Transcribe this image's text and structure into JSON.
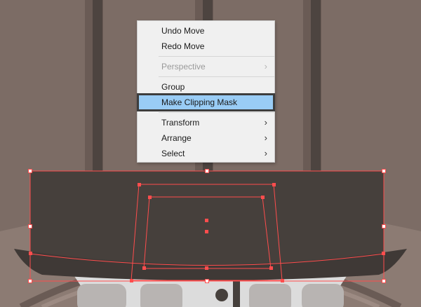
{
  "colors": {
    "background": "#7c6c65",
    "dark_shape": "#46403c",
    "selection": "#ff4d4d",
    "highlight": "#99ccf5"
  },
  "context_menu": {
    "items": [
      {
        "label": "Undo Move",
        "enabled": true
      },
      {
        "label": "Redo Move",
        "enabled": true
      },
      {
        "label": "Perspective",
        "enabled": false,
        "submenu": true
      },
      {
        "label": "Group",
        "enabled": true
      },
      {
        "label": "Make Clipping Mask",
        "enabled": true,
        "highlighted": true
      },
      {
        "label": "Transform",
        "enabled": true,
        "submenu": true
      },
      {
        "label": "Arrange",
        "enabled": true,
        "submenu": true
      },
      {
        "label": "Select",
        "enabled": true,
        "submenu": true
      }
    ],
    "submenu_icon": "chevron-right-icon"
  }
}
